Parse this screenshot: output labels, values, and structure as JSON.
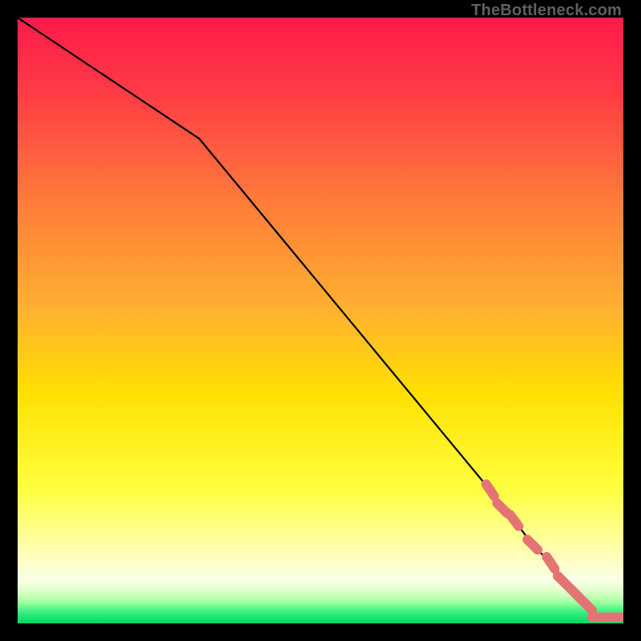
{
  "watermark": "TheBottleneck.com",
  "colors": {
    "marker": "#e57373",
    "line": "#000000",
    "frame": "#000000",
    "grad_top": "#ff1a4b",
    "grad_mid1": "#ff6e3c",
    "grad_mid2": "#ffd400",
    "grad_mid3": "#ffff66",
    "grad_mid4": "#f6ffd0",
    "grad_bottom": "#00e05a"
  },
  "chart_data": {
    "type": "line",
    "title": "",
    "xlabel": "",
    "ylabel": "",
    "xlim": [
      0,
      100
    ],
    "ylim": [
      0,
      100
    ],
    "series": [
      {
        "name": "curve",
        "x": [
          0,
          30,
          78,
          82,
          85,
          88,
          90,
          92,
          94,
          96,
          98,
          100
        ],
        "y": [
          100,
          80,
          22,
          17,
          13,
          10,
          7,
          5,
          3,
          1,
          1,
          1
        ]
      }
    ],
    "markers": {
      "name": "highlight-points",
      "x": [
        78,
        80,
        82,
        85,
        88,
        90,
        92,
        94,
        96,
        98,
        100
      ],
      "y": [
        22,
        19,
        17,
        13,
        10,
        7,
        5,
        3,
        1,
        1,
        1
      ]
    },
    "background": "vertical-gradient red→orange→yellow→pale→green"
  }
}
